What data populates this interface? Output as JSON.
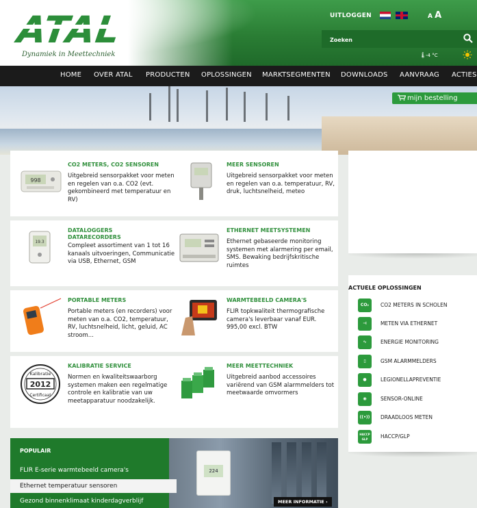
{
  "header": {
    "logo_text": "ATAL",
    "tagline": "Dynamiek in Meettechniek",
    "logout_label": "UITLOGGEN",
    "font_small": "A",
    "font_big": "A",
    "search_placeholder": "Zoeken",
    "weather_text": "-4 °C",
    "brand_color": "#2c8e3a"
  },
  "nav": {
    "items": [
      "HOME",
      "OVER ATAL",
      "PRODUCTEN",
      "OPLOSSINGEN",
      "MARKTSEGMENTEN",
      "DOWNLOADS",
      "AANVRAAG",
      "ACTIES"
    ]
  },
  "hero": {
    "order_label": "mijn bestelling"
  },
  "products": [
    {
      "title": "CO2 METERS, CO2 SENSOREN",
      "text": "Uitgebreid sensorpakket voor meten en regelen van o.a. CO2 (evt. gekombineerd met temperatuur en RV)"
    },
    {
      "title": "MEER SENSOREN",
      "text": "Uitgebreid sensorpakket voor meten en regelen van o.a. temperatuur, RV, druk, luchtsnelheid, meteo"
    },
    {
      "title": "DATALOGGERS\nDATARECORDERS",
      "text": "Compleet assortiment van 1 tot 16 kanaals uitvoeringen, Communicatie via USB, Ethernet, GSM"
    },
    {
      "title": "ETHERNET MEETSYSTEMEN",
      "text": "Ethernet gebaseerde monitoring systemen met alarmering per email, SMS. Bewaking bedrijfskritische ruimtes"
    },
    {
      "title": "PORTABLE METERS",
      "text": "Portable meters (en recorders) voor meten van o.a. CO2, temperatuur, RV, luchtsnelheid, licht, geluid, AC stroom..."
    },
    {
      "title": "WARMTEBEELD CAMERA'S",
      "text": "FLIR topkwaliteit thermografische camera's leverbaar vanaf EUR. 995,00 excl. BTW"
    },
    {
      "title": "KALIBRATIE SERVICE",
      "text": "Normen en kwaliteitswaarborg systemen maken een regelmatige controle en kalibratie van uw meetapparatuur noodzakelijk."
    },
    {
      "title": "MEER MEETTECHNIEK",
      "text": "Uitgebreid aanbod accessoires variërend van GSM alarmmelders tot meetwaarde omvormers"
    }
  ],
  "kalibratie_seal": {
    "top": "Kalibratie",
    "year": "2012",
    "bottom": "Certificaat"
  },
  "solutions": {
    "title": "ACTUELE OPLOSSINGEN",
    "items": [
      {
        "label": "CO2 METERS IN SCHOLEN",
        "icon": "CO₂"
      },
      {
        "label": "METEN VIA ETHERNET",
        "icon": "⊣"
      },
      {
        "label": "ENERGIE MONITORING",
        "icon": "∿"
      },
      {
        "label": "GSM ALARMMELDERS",
        "icon": "▯"
      },
      {
        "label": "LEGIONELLAPREVENTIE",
        "icon": "●"
      },
      {
        "label": "SENSOR-ONLINE",
        "icon": "◉"
      },
      {
        "label": "DRAADLOOS METEN",
        "icon": "((•))"
      },
      {
        "label": "HACCP/GLP",
        "icon": "HACCP GLP"
      }
    ]
  },
  "popular": {
    "title": "POPULAIR",
    "items": [
      "FLIR E-serie warmtebeeld camera's",
      "Ethernet temperatuur sensoren",
      "Gezond binnenklimaat kinderdagverblijf"
    ],
    "sensor_display": "224",
    "more_label": "MEER INFORMATIE"
  }
}
